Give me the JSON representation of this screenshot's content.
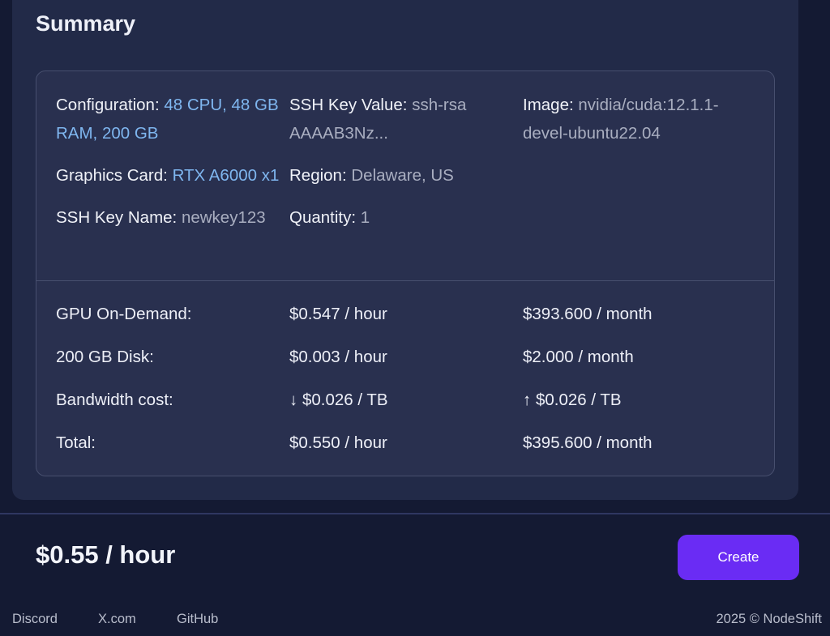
{
  "summary": {
    "title": "Summary",
    "config": {
      "configuration_label": "Configuration:",
      "configuration_value": "48 CPU, 48 GB RAM, 200 GB",
      "ssh_key_value_label": "SSH Key Value:",
      "ssh_key_value_value": "ssh-rsa AAAAB3Nz...",
      "image_label": "Image:",
      "image_value": "nvidia/cuda:12.1.1-devel-ubuntu22.04",
      "graphics_card_label": "Graphics Card:",
      "graphics_card_value": "RTX A6000 x1",
      "region_label": "Region:",
      "region_value": "Delaware, US",
      "ssh_key_name_label": "SSH Key Name:",
      "ssh_key_name_value": "newkey123",
      "quantity_label": "Quantity:",
      "quantity_value": "1"
    },
    "costs": [
      {
        "label": "GPU On-Demand:",
        "hourly": "$0.547 / hour",
        "monthly": "$393.600 / month"
      },
      {
        "label": "200 GB Disk:",
        "hourly": "$0.003 / hour",
        "monthly": "$2.000 / month"
      },
      {
        "label": "Bandwidth cost:",
        "hourly": "↓ $0.026 / TB",
        "monthly": "↑ $0.026 / TB"
      },
      {
        "label": "Total:",
        "hourly": "$0.550 / hour",
        "monthly": "$395.600 / month"
      }
    ]
  },
  "price_total": "$0.55 / hour",
  "create_button_label": "Create",
  "footer": {
    "links": [
      "Discord",
      "X.com",
      "GitHub"
    ],
    "copyright": "2025 © NodeShift"
  },
  "colors": {
    "page_background": "#141a33",
    "card_background": "#222a48",
    "link_value": "#7fb6ef",
    "muted_value": "#a9aec0",
    "create_button": "#6a2cf4"
  }
}
